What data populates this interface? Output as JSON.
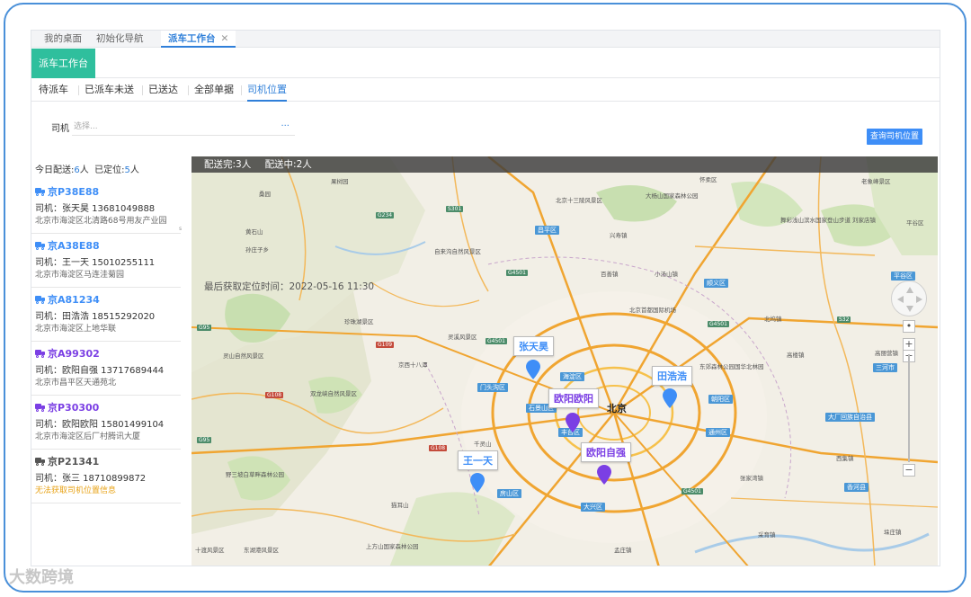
{
  "tabs": [
    {
      "label": "我的桌面"
    },
    {
      "label": "初始化导航"
    },
    {
      "label": "派车工作台",
      "close": "✕"
    }
  ],
  "page_title": "派车工作台",
  "subtabs": [
    "待派车",
    "已派车未送",
    "已送达",
    "全部单据",
    "司机位置"
  ],
  "query": {
    "driver_label": "司机",
    "driver_placeholder": "选择...",
    "dots": "···",
    "search_button": "查询司机位置"
  },
  "summary": {
    "today_label": "今日配送:",
    "today_count": "6",
    "today_unit": "人",
    "located_label": "已定位:",
    "located_count": "5",
    "located_unit": "人"
  },
  "vehicles": [
    {
      "plate": "京P38E88",
      "driver": "司机：张天昊 13681049888",
      "address": "北京市海淀区北清路68号用友产业园",
      "color": "#3e8ef7"
    },
    {
      "plate": "京A38E88",
      "driver": "司机：王一天 15010255111",
      "address": "北京市海淀区马连洼菊园",
      "color": "#3e8ef7"
    },
    {
      "plate": "京A81234",
      "driver": "司机：田浩浩 18515292020",
      "address": "北京市海淀区上地华联",
      "color": "#3e8ef7"
    },
    {
      "plate": "京A99302",
      "driver": "司机：欧阳自强 13717689444",
      "address": "北京市昌平区天通苑北",
      "color": "#7b3fe4"
    },
    {
      "plate": "京P30300",
      "driver": "司机：欧阳欧阳 15801499104",
      "address": "北京市海淀区后厂村腾讯大厦",
      "color": "#7b3fe4"
    },
    {
      "plate": "京P21341",
      "driver": "司机：张三 18710899872",
      "address": "无法获取司机位置信息",
      "color": "#555555"
    }
  ],
  "map": {
    "status_done": "配送完:3人",
    "status_ongoing": "配送中:2人",
    "last_time": "最后获取定位时间：2022-05-16 11:30",
    "city": "北京",
    "markers": [
      {
        "name": "张天昊",
        "color": "#3e8ef7"
      },
      {
        "name": "田浩浩",
        "color": "#3e8ef7"
      },
      {
        "name": "欧阳欧阳",
        "color": "#7b3fe4"
      },
      {
        "name": "欧阳自强",
        "color": "#7b3fe4"
      },
      {
        "name": "王一天",
        "color": "#3e8ef7"
      }
    ],
    "places": [
      "桑园",
      "果树园",
      "黄石山",
      "北京十三陵风景区",
      "大杨山国家森林公园",
      "怀柔区",
      "老象峰景区",
      "舞彩浅山滨水国家登山步道",
      "刘家店镇",
      "平谷区",
      "昌平区",
      "自来沟自然风景区",
      "兴寿镇",
      "百善镇",
      "小汤山镇",
      "平谷区",
      "孙庄子乡",
      "珍珠湖景区",
      "灵溪风景区",
      "北京首都国际机场",
      "顺义区",
      "北坞镇",
      "灵山自然风景区",
      "京西十八潭",
      "海淀区",
      "东郊森林公园国华北林园",
      "高丽营镇",
      "双龙峡自然风景区",
      "门头沟区",
      "石景山区",
      "丰台区",
      "朝阳区",
      "通州区",
      "大厂回族自治县",
      "千灵山",
      "野三坡白草畔森林公园",
      "房山区",
      "大兴区",
      "猫耳山",
      "上方山国家森林公园",
      "十渡风景区",
      "东湖港风景区",
      "香河县",
      "三河市",
      "高楼镇",
      "西集镇",
      "张家湾镇",
      "采育镇",
      "孟庄镇",
      "垛庄镇"
    ],
    "watermark": "大数跨境"
  }
}
